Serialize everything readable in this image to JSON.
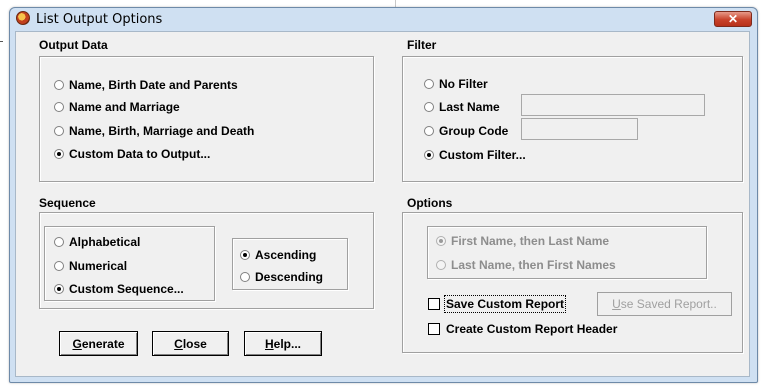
{
  "window": {
    "title": "List Output Options",
    "close_glyph": "✕"
  },
  "output_data": {
    "title": "Output Data",
    "options": [
      {
        "label": "Name, Birth Date and Parents",
        "selected": false
      },
      {
        "label": "Name and Marriage",
        "selected": false
      },
      {
        "label": "Name, Birth, Marriage and Death",
        "selected": false
      },
      {
        "label": "Custom Data to Output...",
        "selected": true
      }
    ]
  },
  "filter": {
    "title": "Filter",
    "options": [
      {
        "label": "No Filter",
        "selected": false
      },
      {
        "label": "Last Name",
        "selected": false,
        "value": ""
      },
      {
        "label": "Group Code",
        "selected": false,
        "value": ""
      },
      {
        "label": "Custom Filter...",
        "selected": true
      }
    ]
  },
  "sequence": {
    "title": "Sequence",
    "options": [
      {
        "label": "Alphabetical",
        "selected": false
      },
      {
        "label": "Numerical",
        "selected": false
      },
      {
        "label": "Custom Sequence...",
        "selected": true
      }
    ],
    "order": [
      {
        "label": "Ascending",
        "selected": true
      },
      {
        "label": "Descending",
        "selected": false
      }
    ]
  },
  "options": {
    "title": "Options",
    "name_order": [
      {
        "label": "First Name, then Last Name",
        "selected": true,
        "enabled": false
      },
      {
        "label": "Last Name, then First Names",
        "selected": false,
        "enabled": false
      }
    ],
    "save_custom_report": {
      "label": "Save Custom Report",
      "checked": false
    },
    "use_saved_report": {
      "label_accel": "U",
      "label_rest": "se Saved Report..",
      "enabled": false
    },
    "create_custom_header": {
      "label": "Create Custom Report Header",
      "checked": false
    }
  },
  "buttons": {
    "generate": {
      "accel": "G",
      "rest": "enerate"
    },
    "close": {
      "accel": "C",
      "rest": "lose"
    },
    "help": {
      "accel": "H",
      "rest": "elp..."
    }
  }
}
